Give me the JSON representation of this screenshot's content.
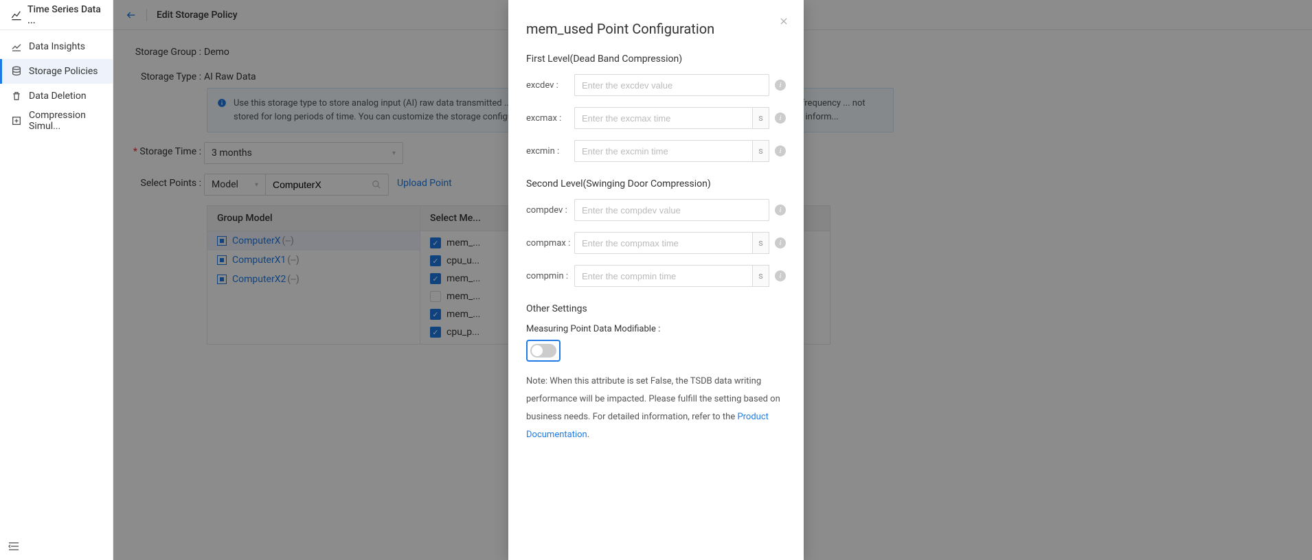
{
  "sidebar": {
    "appTitle": "Time Series Data ...",
    "items": [
      {
        "label": "Data Insights"
      },
      {
        "label": "Storage Policies"
      },
      {
        "label": "Data Deletion"
      },
      {
        "label": "Compression Simul..."
      }
    ]
  },
  "header": {
    "title": "Edit Storage Policy"
  },
  "page": {
    "storageGroupLabel": "Storage Group :",
    "storageGroupValue": "Demo",
    "storageTypeLabel": "Storage Type :",
    "storageTypeValue": " AI Raw Data",
    "alertText": "Use this storage type to store analog input (AI) raw data transmitted ... processing engine. Because of the huge data amount and high changing frequency ... not stored for long periods of time. You can customize the storage configurat... specific time range through the Get Asset AI Raw Data API. For more inform...",
    "storageTimeLabel": "Storage Time :",
    "storageTimeValue": "3 months",
    "selectPointsLabel": "Select Points :",
    "modelSelectValue": "Model",
    "modelSearchValue": "ComputerX",
    "uploadLink": "Upload Point",
    "table": {
      "groupHeader": "Group Model",
      "pointsHeader": "Select Me...",
      "groups": [
        {
          "name": "ComputerX",
          "tail": "(--)",
          "selected": true
        },
        {
          "name": "ComputerX1",
          "tail": "(--)",
          "selected": false
        },
        {
          "name": "ComputerX2",
          "tail": "(--)",
          "selected": false
        }
      ],
      "points": [
        {
          "name": "mem_...",
          "checked": true
        },
        {
          "name": "cpu_u...",
          "checked": true
        },
        {
          "name": "mem_...",
          "checked": true
        },
        {
          "name": "mem_...",
          "checked": false
        },
        {
          "name": "mem_...",
          "checked": true
        },
        {
          "name": "cpu_p...",
          "checked": true
        }
      ]
    }
  },
  "modal": {
    "title": "mem_used Point Configuration",
    "section1": "First Level(Dead Band Compression)",
    "excdevLabel": "excdev :",
    "excdevPlaceholder": "Enter the excdev value",
    "excmaxLabel": "excmax :",
    "excmaxPlaceholder": "Enter the excmax time",
    "excminLabel": "excmin :",
    "excminPlaceholder": "Enter the excmin time",
    "unitS": "s",
    "section2": "Second Level(Swinging Door Compression)",
    "compdevLabel": "compdev :",
    "compdevPlaceholder": "Enter the compdev value",
    "compmaxLabel": "compmax :",
    "compmaxPlaceholder": "Enter the compmax time",
    "compminLabel": "compmin :",
    "compminPlaceholder": "Enter the compmin time",
    "section3": "Other Settings",
    "modifiableLabel": "Measuring Point Data Modifiable :",
    "notePrefix": "Note: When this attribute is set False, the TSDB data writing performance will be impacted. Please fulfill the setting based on business needs. For detailed information, refer to the ",
    "linkText": "Product Documentation",
    "linkSuffix": "."
  }
}
